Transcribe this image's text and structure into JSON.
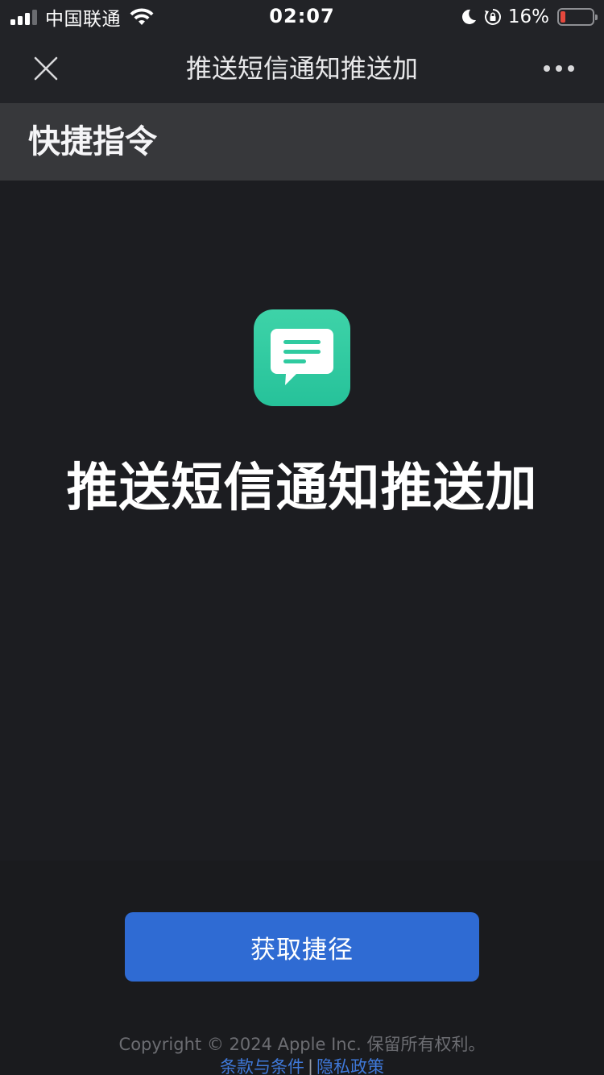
{
  "status_bar": {
    "carrier": "中国联通",
    "time": "02:07",
    "battery_percent": "16%",
    "battery_level": 0.16,
    "battery_color": "#e5483d",
    "icons": [
      "signal-icon",
      "wifi-icon",
      "moon-icon",
      "orientation-lock-icon",
      "battery-icon"
    ]
  },
  "nav": {
    "title": "推送短信通知推送加",
    "close_icon": "close-icon",
    "more_icon": "more-icon"
  },
  "section": {
    "title": "快捷指令"
  },
  "shortcut": {
    "icon": "chat-bubble-icon",
    "icon_color": "#2fcba0",
    "title": "推送短信通知推送加"
  },
  "actions": {
    "get_button_label": "获取捷径",
    "button_color": "#2f6bd3"
  },
  "footer": {
    "copyright": "Copyright © 2024 Apple Inc. 保留所有权利。",
    "terms_label": "条款与条件",
    "separator": "|",
    "privacy_label": "隐私政策"
  }
}
